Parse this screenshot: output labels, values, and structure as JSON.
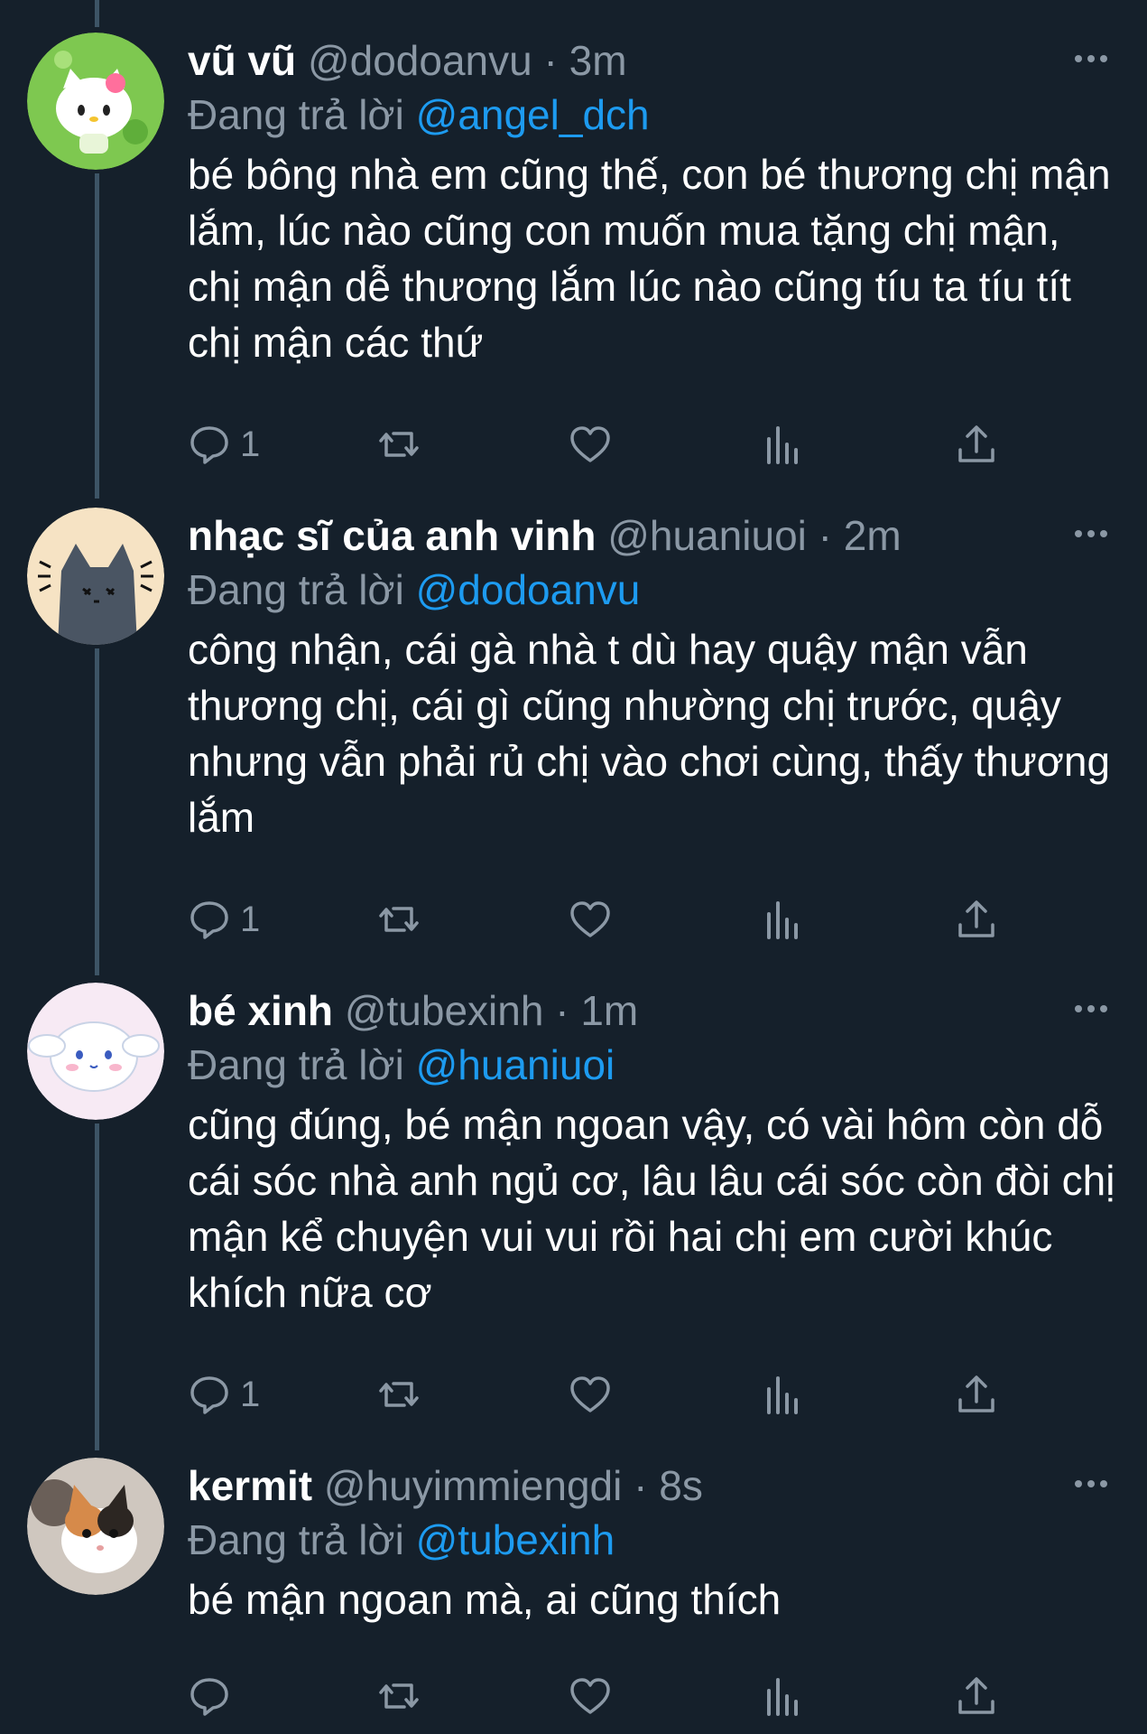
{
  "colors": {
    "background": "#15202b",
    "text": "#ffffff",
    "secondary": "#8b98a5",
    "mention": "#1d9bf0",
    "thread_line": "#3d5466"
  },
  "separator": "·",
  "reply_prefix": "Đang trả lời",
  "tweets": [
    {
      "name": "vũ vũ",
      "handle": "@dodoanvu",
      "time": "3m",
      "reply_to": "@angel_dch",
      "text": "bé bông nhà em cũng thế, con bé thương chị mận lắm, lúc nào cũng con muốn mua tặng chị mận, chị mận dễ thương lắm lúc nào cũng tíu ta tíu tít chị mận các thứ",
      "reply_count": "1",
      "avatar_icon": "hello-kitty-avatar"
    },
    {
      "name": "nhạc sĩ của anh vinh",
      "handle": "@huaniuoi",
      "time": "2m",
      "reply_to": "@dodoanvu",
      "text": "công nhận, cái gà nhà t dù hay quậy mận vẫn thương chị, cái gì cũng nhường chị trước, quậy nhưng vẫn phải rủ chị vào chơi cùng, thấy thương lắm",
      "reply_count": "1",
      "avatar_icon": "grey-cat-avatar"
    },
    {
      "name": "bé xinh",
      "handle": "@tubexinh",
      "time": "1m",
      "reply_to": "@huaniuoi",
      "text": "cũng đúng, bé mận ngoan vậy, có vài hôm còn dỗ cái sóc nhà anh ngủ cơ, lâu lâu cái sóc còn đòi chị mận kể chuyện vui vui rồi hai chị em cười khúc khích nữa cơ",
      "reply_count": "1",
      "avatar_icon": "cinnamoroll-avatar"
    },
    {
      "name": "kermit",
      "handle": "@huyimmiengdi",
      "time": "8s",
      "reply_to": "@tubexinh",
      "text": "bé mận ngoan mà, ai cũng thích",
      "reply_count": "",
      "avatar_icon": "calico-cat-photo-avatar"
    }
  ]
}
